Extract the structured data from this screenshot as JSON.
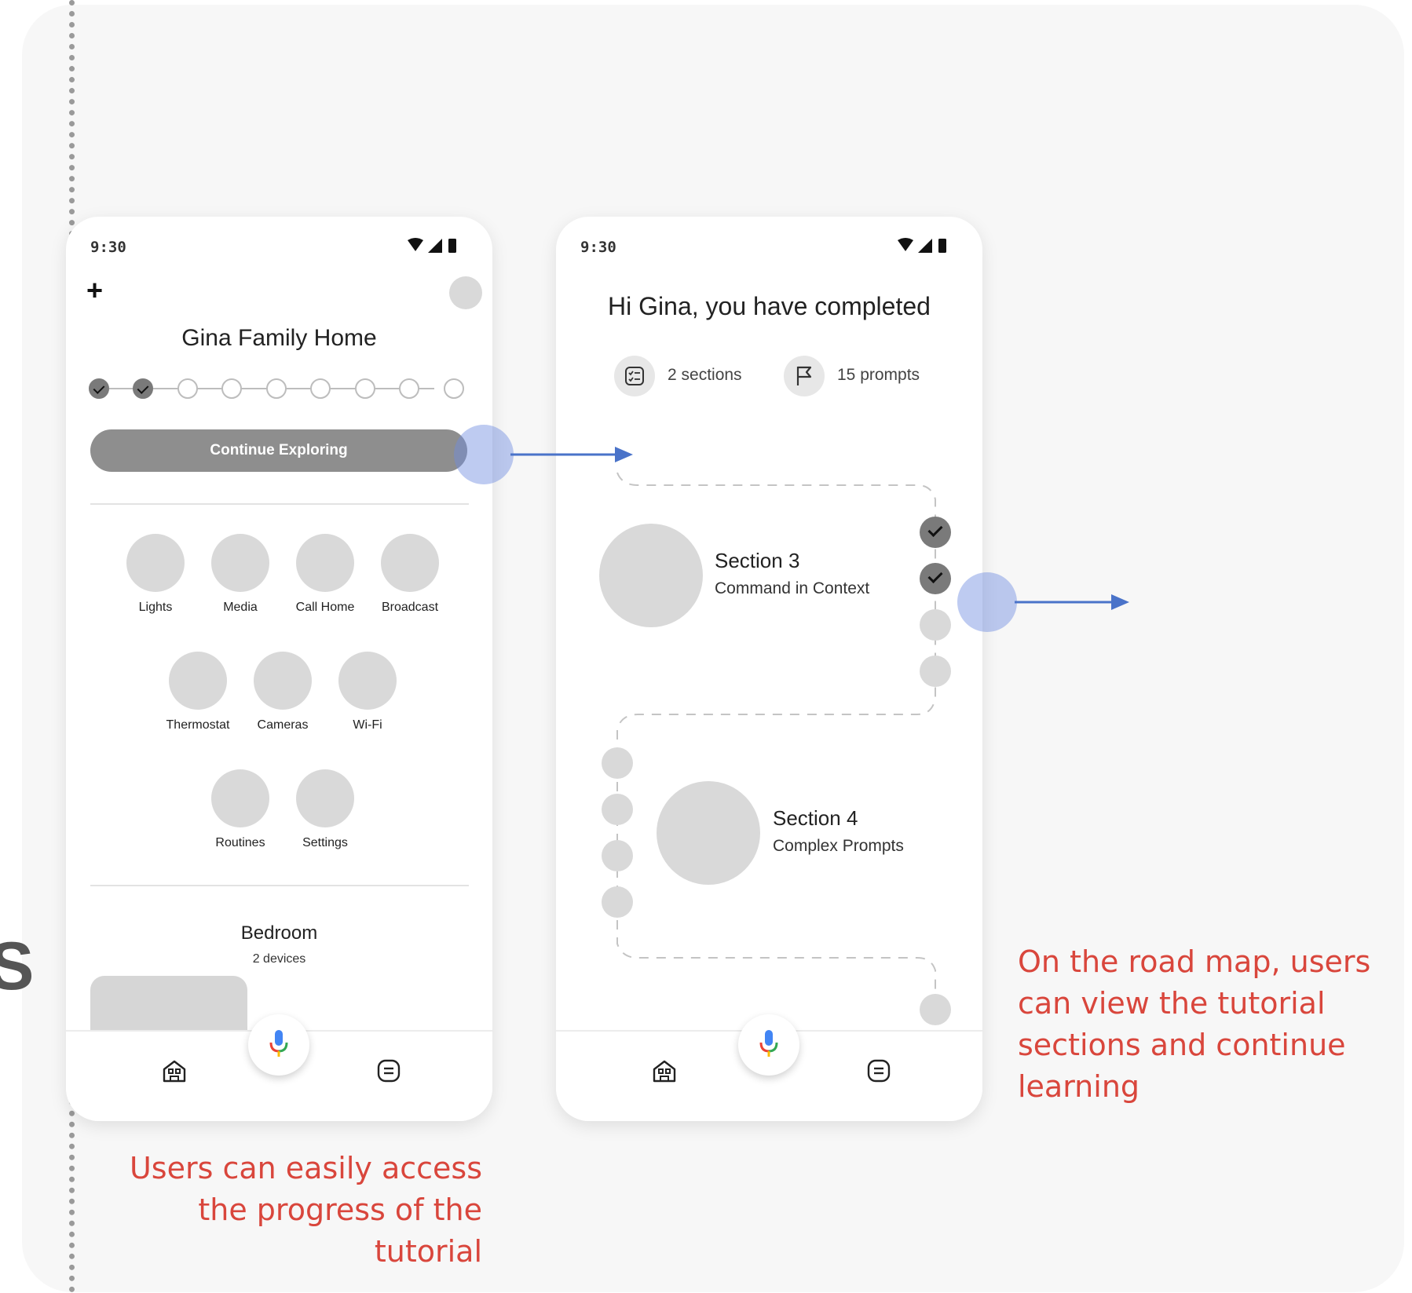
{
  "screen1": {
    "status_time": "9:30",
    "title": "Gina Family Home",
    "progress": {
      "completed": 2,
      "total": 9
    },
    "continue_label": "Continue Exploring",
    "tiles": [
      "Lights",
      "Media",
      "Call Home",
      "Broadcast",
      "Thermostat",
      "Cameras",
      "Wi-Fi",
      "Routines",
      "Settings"
    ],
    "room": {
      "name": "Bedroom",
      "devices": "2 devices"
    }
  },
  "screen2": {
    "status_time": "9:30",
    "greeting": "Hi Gina, you have completed",
    "sections_count": "2 sections",
    "prompts_count": "15 prompts",
    "section3": {
      "title": "Section 3",
      "subtitle": "Command in Context"
    },
    "section4": {
      "title": "Section 4",
      "subtitle": "Complex Prompts"
    }
  },
  "annotations": {
    "note1": "Users can easily access the progress of the tutorial",
    "note2": "On the road map, users can view the tutorial sections and continue learning"
  },
  "colors": {
    "annotation": "#d9463c",
    "touch_indicator": "#6e8ce1",
    "arrow": "#4a73c9",
    "mic_blue": "#4285f4",
    "mic_red": "#ea4335",
    "mic_yellow": "#fbbc04",
    "mic_green": "#34a853"
  },
  "icons": [
    "plus-icon",
    "avatar",
    "wifi-icon",
    "signal-icon",
    "battery-icon",
    "home-icon",
    "mic-icon",
    "list-icon",
    "checklist-icon",
    "flag-icon",
    "check-icon"
  ]
}
